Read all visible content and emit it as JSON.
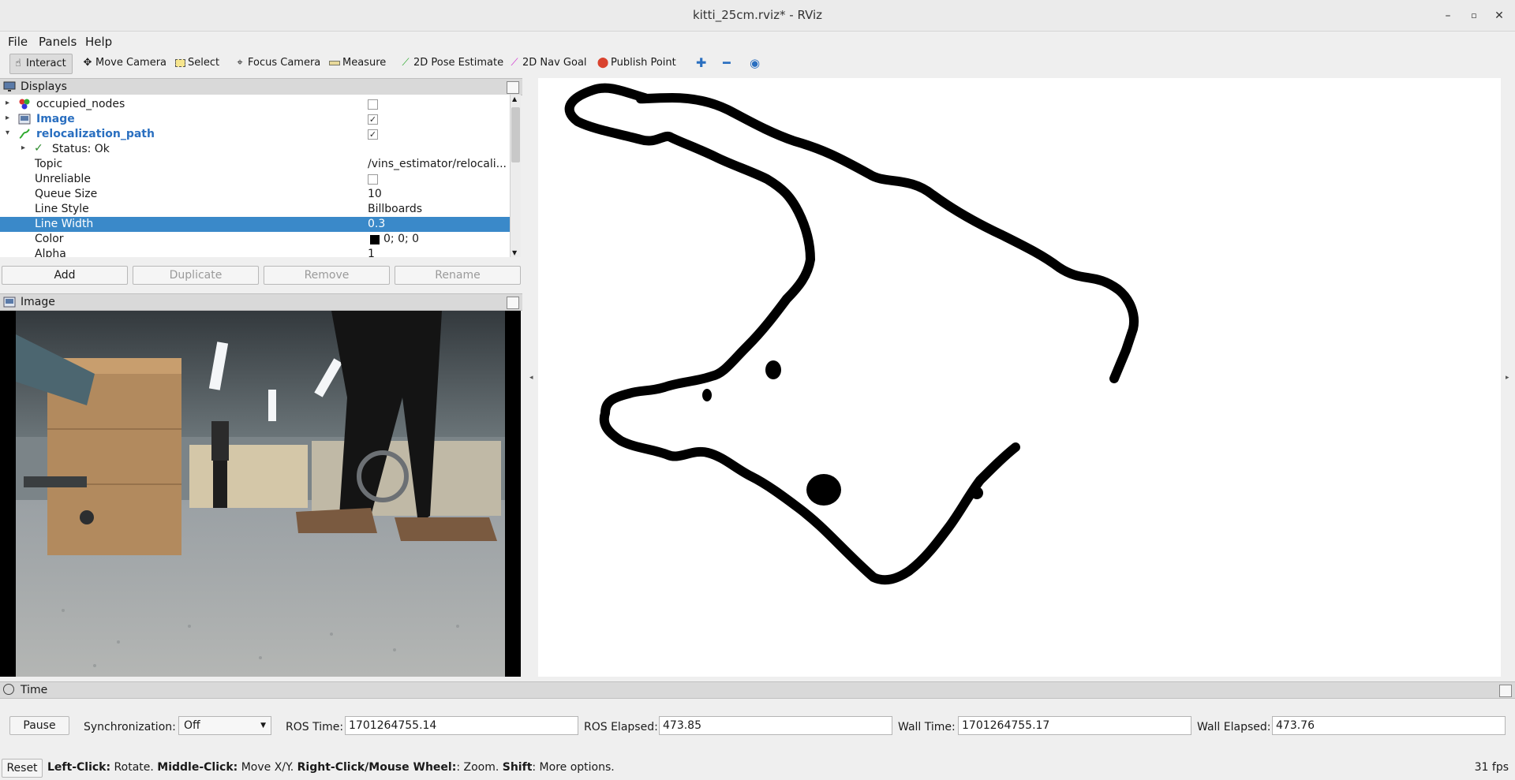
{
  "window": {
    "title": "kitti_25cm.rviz* - RViz"
  },
  "menu": {
    "items": [
      "File",
      "Panels",
      "Help"
    ]
  },
  "toolbar": {
    "interact": "Interact",
    "move_camera": "Move Camera",
    "select": "Select",
    "focus_camera": "Focus Camera",
    "measure": "Measure",
    "pose_estimate": "2D Pose Estimate",
    "nav_goal": "2D Nav Goal",
    "publish_point": "Publish Point"
  },
  "displays": {
    "title": "Displays",
    "rows": {
      "occupied_nodes": "occupied_nodes",
      "image": "Image",
      "relocalization_path": "relocalization_path",
      "status": "Status: Ok",
      "topic_label": "Topic",
      "topic_value": "/vins_estimator/relocali...",
      "unreliable_label": "Unreliable",
      "queue_label": "Queue Size",
      "queue_value": "10",
      "line_style_label": "Line Style",
      "line_style_value": "Billboards",
      "line_width_label": "Line Width",
      "line_width_value": "0.3",
      "color_label": "Color",
      "color_value": "0; 0; 0",
      "alpha_label": "Alpha",
      "alpha_value": "1"
    },
    "buttons": {
      "add": "Add",
      "duplicate": "Duplicate",
      "remove": "Remove",
      "rename": "Rename"
    }
  },
  "image_panel": {
    "title": "Image"
  },
  "time_panel": {
    "title": "Time",
    "pause": "Pause",
    "sync_label": "Synchronization:",
    "sync_value": "Off",
    "ros_time_label": "ROS Time:",
    "ros_time": "1701264755.14",
    "ros_elapsed_label": "ROS Elapsed:",
    "ros_elapsed": "473.85",
    "wall_time_label": "Wall Time:",
    "wall_time": "1701264755.17",
    "wall_elapsed_label": "Wall Elapsed:",
    "wall_elapsed": "473.76"
  },
  "status_bar": {
    "reset": "Reset",
    "hint_left_click": "Left-Click:",
    "hint_rotate": " Rotate. ",
    "hint_middle_click": "Middle-Click:",
    "hint_move": " Move X/Y. ",
    "hint_right_click": "Right-Click/Mouse Wheel:",
    "hint_zoom": ": Zoom. ",
    "hint_shift": "Shift",
    "hint_more": ": More options.",
    "fps": "31 fps"
  },
  "colors": {
    "selection": "#3a89c9",
    "path": "#000000",
    "path_label": "#2a6fc0"
  }
}
